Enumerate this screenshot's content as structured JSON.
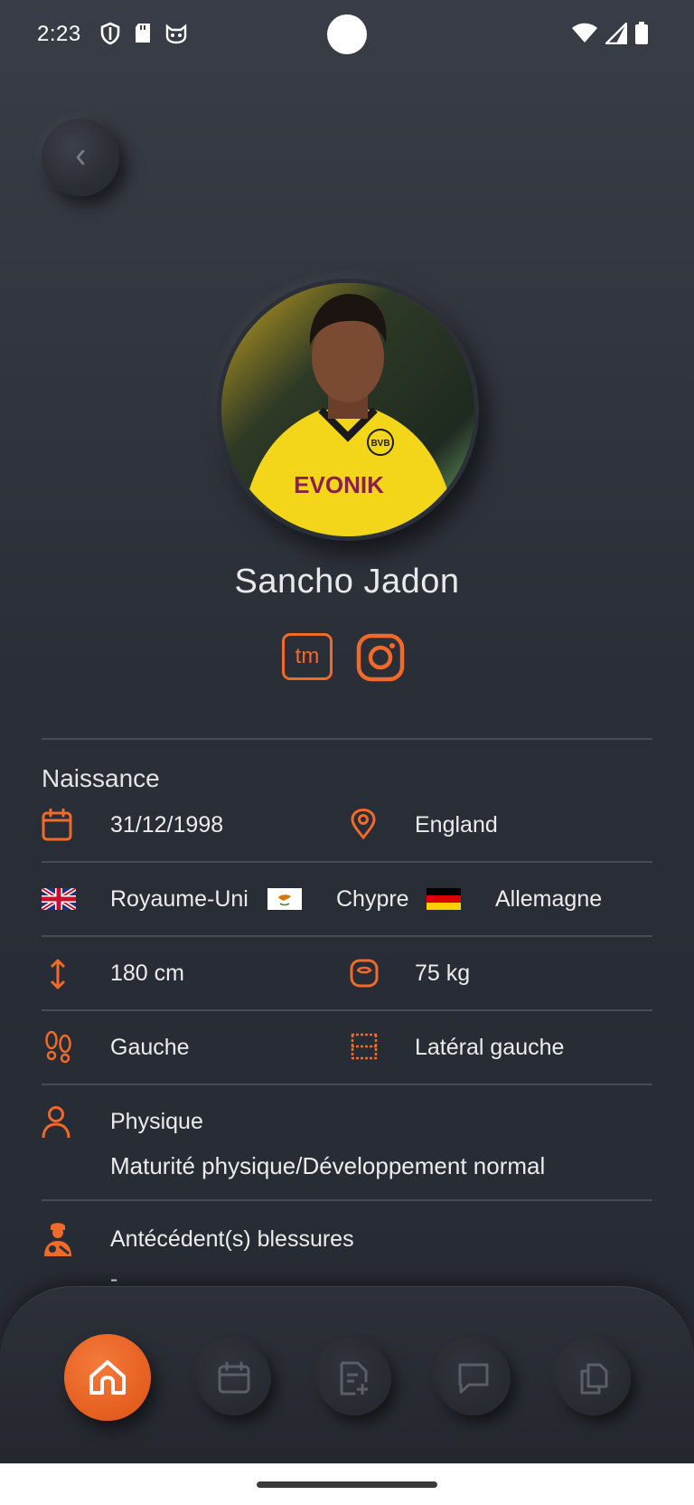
{
  "status_bar": {
    "time": "2:23",
    "left_icons": [
      "shield-icon",
      "sd-card-icon",
      "cat-face-icon"
    ],
    "right_icons": [
      "wifi-icon",
      "cell-signal-icon",
      "battery-icon"
    ]
  },
  "back_button": {
    "icon": "chevron-left-icon"
  },
  "player": {
    "name": "Sancho Jadon",
    "photo_jersey_text": "EVONIK",
    "photo_badge_text": "BVB"
  },
  "social": {
    "transfermarkt_label": "tm",
    "instagram_icon": "instagram-icon"
  },
  "birth": {
    "section_title": "Naissance",
    "date": "31/12/1998",
    "place": "England"
  },
  "nationalities": {
    "items": [
      "Royaume-Uni",
      "Chypre",
      "Allemagne"
    ]
  },
  "measurements": {
    "height": "180 cm",
    "weight": "75 kg"
  },
  "play": {
    "foot": "Gauche",
    "position": "Latéral gauche"
  },
  "physique": {
    "label": "Physique",
    "value": "Maturité physique/Développement normal"
  },
  "injuries": {
    "label": "Antécédent(s) blessures",
    "value": "-"
  },
  "bottom_nav": {
    "items": [
      "home-icon",
      "calendar-icon",
      "document-add-icon",
      "chat-icon",
      "copy-icon"
    ],
    "active": "home-icon"
  },
  "colors": {
    "accent": "#f06a2a",
    "background": "#2a2e37",
    "text": "#ececec",
    "divider": "#474b54"
  }
}
